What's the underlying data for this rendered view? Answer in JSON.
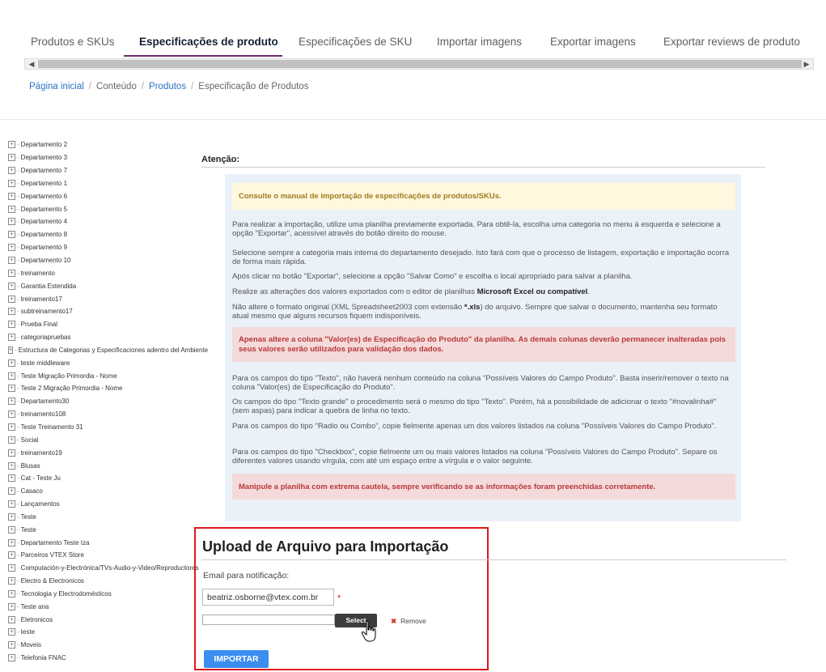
{
  "tabs": [
    {
      "label": "Produtos e SKUs",
      "active": false
    },
    {
      "label": "Especificações de produto",
      "active": true
    },
    {
      "label": "Especificações de SKU",
      "active": false
    },
    {
      "label": "Importar imagens",
      "active": false
    },
    {
      "label": "Exportar imagens",
      "active": false
    },
    {
      "label": "Exportar reviews de produto",
      "active": false
    }
  ],
  "breadcrumb": {
    "home": "Página inicial",
    "content": "Conteúdo",
    "products": "Produtos",
    "current": "Especificação de Produtos",
    "separator": "/"
  },
  "tree": {
    "items": [
      "Departamento 2",
      "Departamento 3",
      "Departamento 7",
      "Departamento 1",
      "Departamento 6",
      "Departamento 5",
      "Departamento 4",
      "Departamento 8",
      "Departamento 9",
      "Departamento 10",
      "treinamento",
      "Garantia Estendida",
      "treinamento17",
      "subtreinamento17",
      "Prueba Final",
      "categoriapruebas",
      "Estructura de Categorias y Especificaciones adentro del Ambiente",
      "teste middleware",
      "Teste Migração Primordia - Nome",
      "Teste 2 Migração Primordia - Nome",
      "Departamento30",
      "treinamento108",
      "Teste Treinamento 31",
      "Social",
      "treinamento19",
      "Blusas",
      "Cat - Teste Ju",
      "Casaco",
      "Lançamentos",
      "Teste",
      "Teste",
      "Departamento Teste Iza",
      "Parceiros VTEX Store",
      "Computación-y-Electrónica/TVs-Audio-y-Video/Reproductores",
      "Electro & Electronicos",
      "Tecnologia y Electrodomésticos",
      "Teste ana",
      "Eletronicos",
      "teste",
      "Moveis",
      "Telefonia FNAC"
    ]
  },
  "attention": {
    "title": "Atenção:",
    "manual_note": "Consulte o manual de importação de especificações de produtos/SKUs.",
    "p1": "Para realizar a importação, utilize uma planilha previamente exportada. Para obtê-la, escolha uma categoria no menu à esquerda e selecione a opção \"Exportar\", acessível através do botão direito do mouse.",
    "p2": "Selecione sempre a categoria mais interna do departamento desejado. Isto fará com que o processo de listagem, exportação e importação ocorra de forma mais rápida.",
    "p3": "Após clicar no botão \"Exportar\", selecione a opção \"Salvar Como\" e escolha o local apropriado para salvar a planilha.",
    "p4_prefix": "Realize as alterações dos valores exportados com o editor de planilhas ",
    "p4_bold": "Microsoft Excel ou compatível",
    "p4_suffix": ".",
    "p5_prefix": "Não altere o formato original (XML Spreadsheet2003 com extensão ",
    "p5_bold": "*.xls",
    "p5_suffix": ") do arquivo. Sempre que salvar o documento, mantenha seu formato atual mesmo que alguns recursos fiquem indisponíveis.",
    "warning1": "Apenas altere a coluna \"Valor(es) de Especificação do Produto\" da planilha. As demais colunas deverão permanecer inalteradas pois seus valores serão utilizados para validação dos dados.",
    "p6": "Para os campos do tipo \"Texto\", não haverá nenhum conteúdo na coluna \"Possíveis Valores do Campo Produto\". Basta inserir/remover o texto na coluna \"Valor(es) de Especificação do Produto\".",
    "p7": "Os campos do tipo \"Texto grande\" o procedimento será o mesmo do tipo \"Texto\". Porém, há a possibilidade de adicionar o texto \"#novalinha#\" (sem aspas) para indicar a quebra de linha no texto.",
    "p8": "Para os campos do tipo \"Radio ou Combo\", copie fielmente apenas um dos valores listados na coluna \"Possíveis Valores do Campo Produto\".",
    "p9": "Para os campos do tipo \"Checkbox\", copie fielmente um ou mais valores listados na coluna \"Possíveis Valores do Campo Produto\". Separe os diferentes valores usando vírgula, com até um espaço entre a vírgula e o valor seguinte.",
    "warning2": "Manipule a planilha com extrema cautela, sempre verificando se as informações foram preenchidas corretamente."
  },
  "upload": {
    "title": "Upload de Arquivo para Importação",
    "email_label": "Email para notificação:",
    "email_value": "beatriz.osborne@vtex.com.br",
    "required_mark": "*",
    "select_label": "Select",
    "remove_label": "Remove",
    "remove_glyph": "✖",
    "import_label": "IMPORTAR"
  },
  "scrollbar": {
    "left_arrow": "◀",
    "right_arrow": "▶"
  },
  "colors": {
    "accent": "#6d2b6e",
    "link": "#2b74c5",
    "primary_button": "#3b8df0",
    "highlight_border": "#e0171b"
  }
}
